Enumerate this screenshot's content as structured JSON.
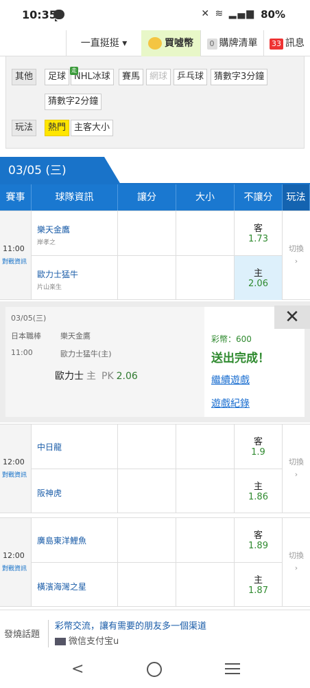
{
  "status": {
    "time": "10:35",
    "battery": "80%"
  },
  "topmenu": {
    "sort": "一直挺挺 ▾",
    "buy": "買噓幣",
    "cart_count": "0",
    "cart": "購牌清單",
    "msg_count": "33",
    "msg": "訊息"
  },
  "filter": {
    "other_label": "其他",
    "other_items": [
      "足球",
      "NHL冰球",
      "賽馬",
      "網球",
      "乒乓球",
      "猜數字3分鐘",
      "猜數字2分鐘"
    ],
    "mode_label": "玩法",
    "mode_items": [
      "熱門",
      "主客大小"
    ]
  },
  "date": "03/05 (三)",
  "columns": [
    "賽事",
    "球隊資訊",
    "讓分",
    "大小",
    "不讓分",
    "玩法"
  ],
  "matches": [
    {
      "time": "11:00",
      "h2h": "對戰資訊",
      "away": {
        "name": "樂天金鷹",
        "pitcher": "岸孝之",
        "side": "客",
        "odds": "1.73"
      },
      "home": {
        "name": "歐力士猛牛",
        "pitcher": "片山楽生",
        "side": "主",
        "odds": "2.06"
      },
      "switch": "切換"
    },
    {
      "time": "12:00",
      "h2h": "對戰資訊",
      "away": {
        "name": "中日龍",
        "side": "客",
        "odds": "1.9"
      },
      "home": {
        "name": "阪神虎",
        "side": "主",
        "odds": "1.86"
      },
      "switch": "切換"
    },
    {
      "time": "12:00",
      "h2h": "對戰資訊",
      "away": {
        "name": "廣島東洋鯉魚",
        "side": "客",
        "odds": "1.89"
      },
      "home": {
        "name": "橫濱海灣之星",
        "side": "主",
        "odds": "1.87"
      },
      "switch": "切換"
    }
  ],
  "popup": {
    "date": "03/05(三)",
    "league": "日本職棒",
    "time": "11:00",
    "team1": "樂天金鷹",
    "team2": "歐力士猛牛(主)",
    "pick_team": "歐力士",
    "pick_side": "主",
    "pick_type": "PK",
    "pick_odds": "2.06",
    "credits": "彩幣：600",
    "done": "送出完成！",
    "continue": "繼續遊戲",
    "record": "遊戲紀錄"
  },
  "promo": {
    "tag": "發燒話題",
    "title": "彩幣交流，讓有需要的朋友多一個渠道",
    "sub": "微信支付宝u"
  }
}
